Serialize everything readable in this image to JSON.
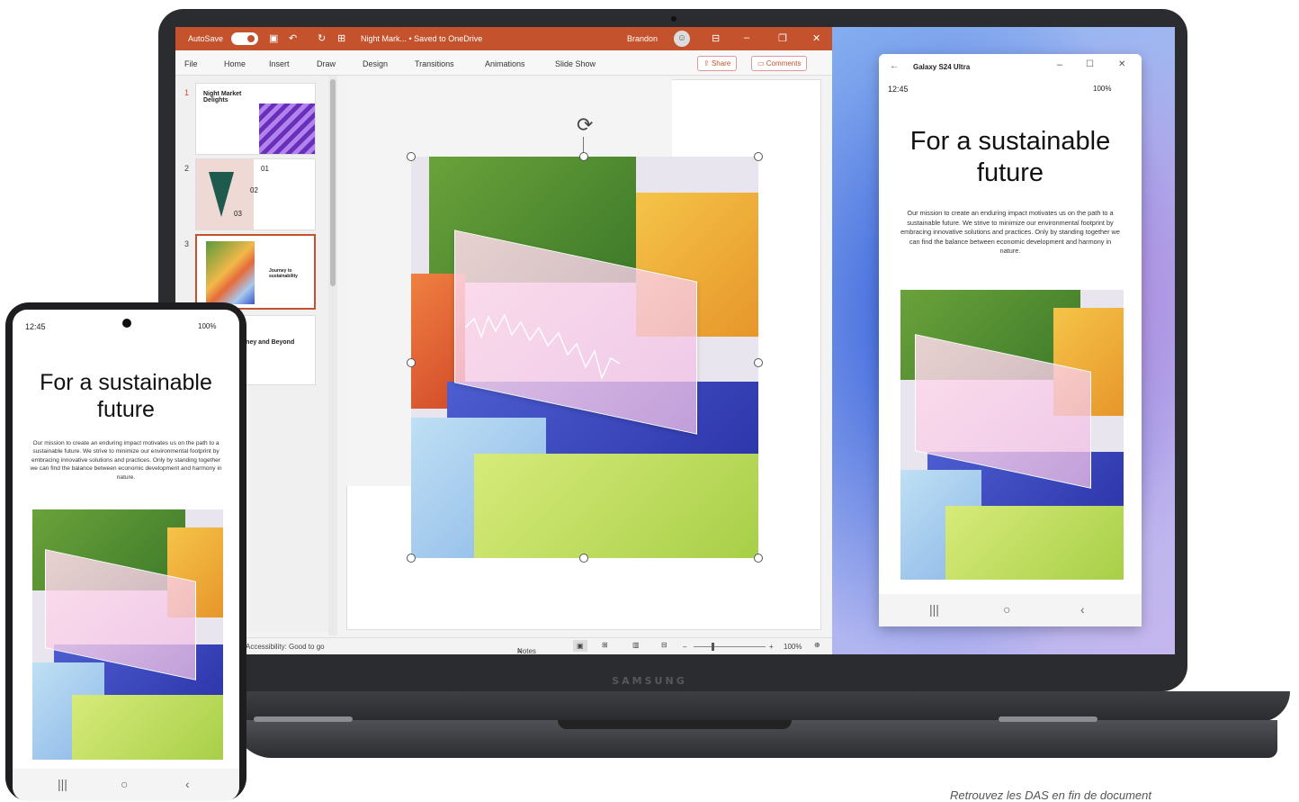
{
  "ppt": {
    "autosave_label": "AutoSave",
    "autosave_state": "On",
    "doc_title": "Night Mark... • Saved to OneDrive",
    "user": "Brandon",
    "tabs": [
      "File",
      "Home",
      "Insert",
      "Draw",
      "Design",
      "Transitions",
      "Animations",
      "Slide Show"
    ],
    "share_label": "Share",
    "comments_label": "Comments",
    "slides": [
      {
        "num": "1",
        "title": "Night Market Delights"
      },
      {
        "num": "2",
        "items": [
          "01",
          "02",
          "03"
        ]
      },
      {
        "num": "3",
        "title": "Journey to sustainability"
      },
      {
        "num": "",
        "title": "Journey and Beyond"
      }
    ],
    "status": {
      "accessibility": "Accessibility: Good to go",
      "notes": "Notes",
      "zoom": "100%"
    }
  },
  "phone_window": {
    "title": "Galaxy S24 Ultra",
    "time": "12:45",
    "signal": "100%",
    "heading": "For a sustainable future",
    "body": "Our mission to create an enduring impact motivates us on the path to a sustainable future. We strive to minimize our environmental footprint by embracing innovative solutions and practices. Only by standing together we can find the balance between economic development and harmony in nature."
  },
  "phone": {
    "time": "12:45",
    "signal": "100%",
    "heading": "For a sustainable future",
    "body": "Our mission to create an enduring impact motivates us on the path to a sustainable future. We strive to minimize our environmental footprint by embracing innovative solutions and practices. Only by standing together we can find the balance between economic development and harmony in nature."
  },
  "laptop_brand": "SAMSUNG",
  "disclaimer": "Retrouvez les DAS en fin de document",
  "colors": {
    "ppt_accent": "#c4522d"
  }
}
